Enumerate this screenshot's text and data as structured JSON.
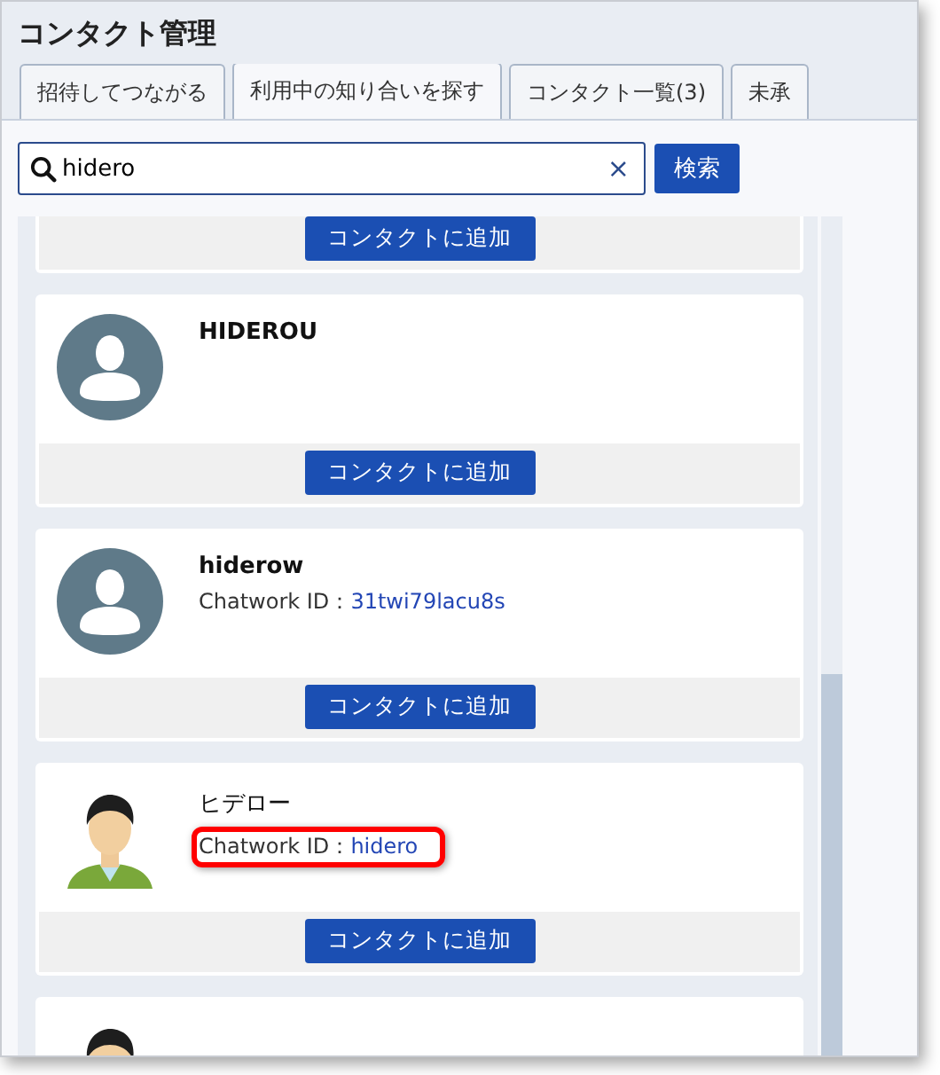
{
  "window": {
    "title": "コンタクト管理"
  },
  "tabs": [
    {
      "label": "招待してつながる",
      "selected": false
    },
    {
      "label": "利用中の知り合いを探す",
      "selected": true
    },
    {
      "label": "コンタクト一覧(3)",
      "selected": false
    },
    {
      "label": "未承",
      "selected": false
    }
  ],
  "search": {
    "value": "hidero",
    "clear": "×",
    "button": "検索"
  },
  "results": [
    {
      "kind": "footer",
      "button": "コンタクトに追加"
    },
    {
      "kind": "default",
      "name": "HIDEROU",
      "bold": true,
      "button": "コンタクトに追加"
    },
    {
      "kind": "default",
      "name": "hiderow",
      "bold": true,
      "id_label": "Chatwork ID：",
      "id_value": "31twi79lacu8s",
      "highlighted": false,
      "button": "コンタクトに追加"
    },
    {
      "name": "ヒデロー",
      "bold": false,
      "id_label": "Chatwork ID：",
      "id_value": "hidero",
      "highlighted": true,
      "button": "コンタクトに追加"
    },
    {
      "kind": "photo_top"
    }
  ]
}
